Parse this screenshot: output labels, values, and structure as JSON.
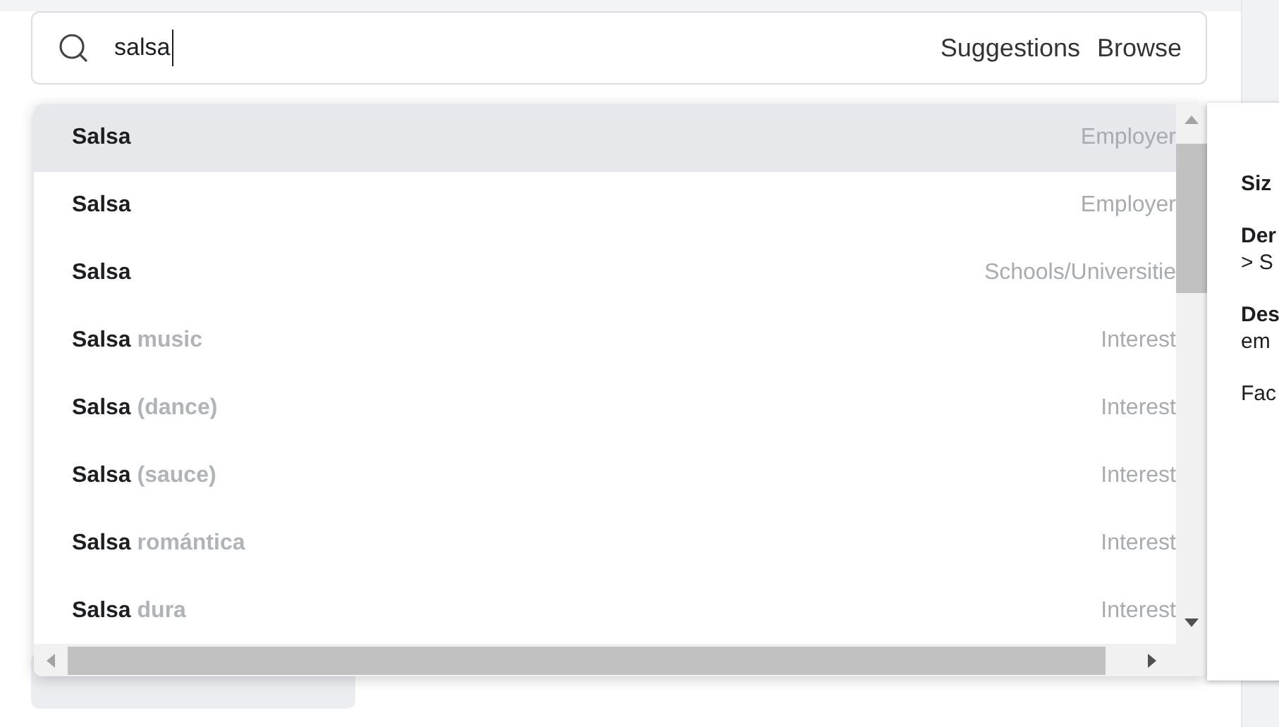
{
  "search": {
    "value": "salsa",
    "links": [
      "Suggestions",
      "Browse"
    ]
  },
  "results": [
    {
      "name": "Salsa",
      "category": "Employer",
      "selected": true
    },
    {
      "name": "Salsa",
      "category": "Employer",
      "selected": false
    },
    {
      "name": "Salsa",
      "category": "Schools/Universitie",
      "selected": false
    },
    {
      "name": "Salsa",
      "detail": "music",
      "category": "Interest",
      "selected": false
    },
    {
      "name": "Salsa",
      "detail": "(dance)",
      "category": "Interest",
      "selected": false
    },
    {
      "name": "Salsa",
      "detail": "(sauce)",
      "category": "Interest",
      "selected": false
    },
    {
      "name": "Salsa",
      "detail": "romántica",
      "category": "Interest",
      "selected": false
    },
    {
      "name": "Salsa",
      "detail": "dura",
      "category": "Interest",
      "selected": false
    }
  ],
  "details": [
    {
      "label": "Siz"
    },
    {
      "label": "Der",
      "text": "> S"
    },
    {
      "label": "Des",
      "text": "em"
    },
    {
      "text": "Fac"
    }
  ]
}
